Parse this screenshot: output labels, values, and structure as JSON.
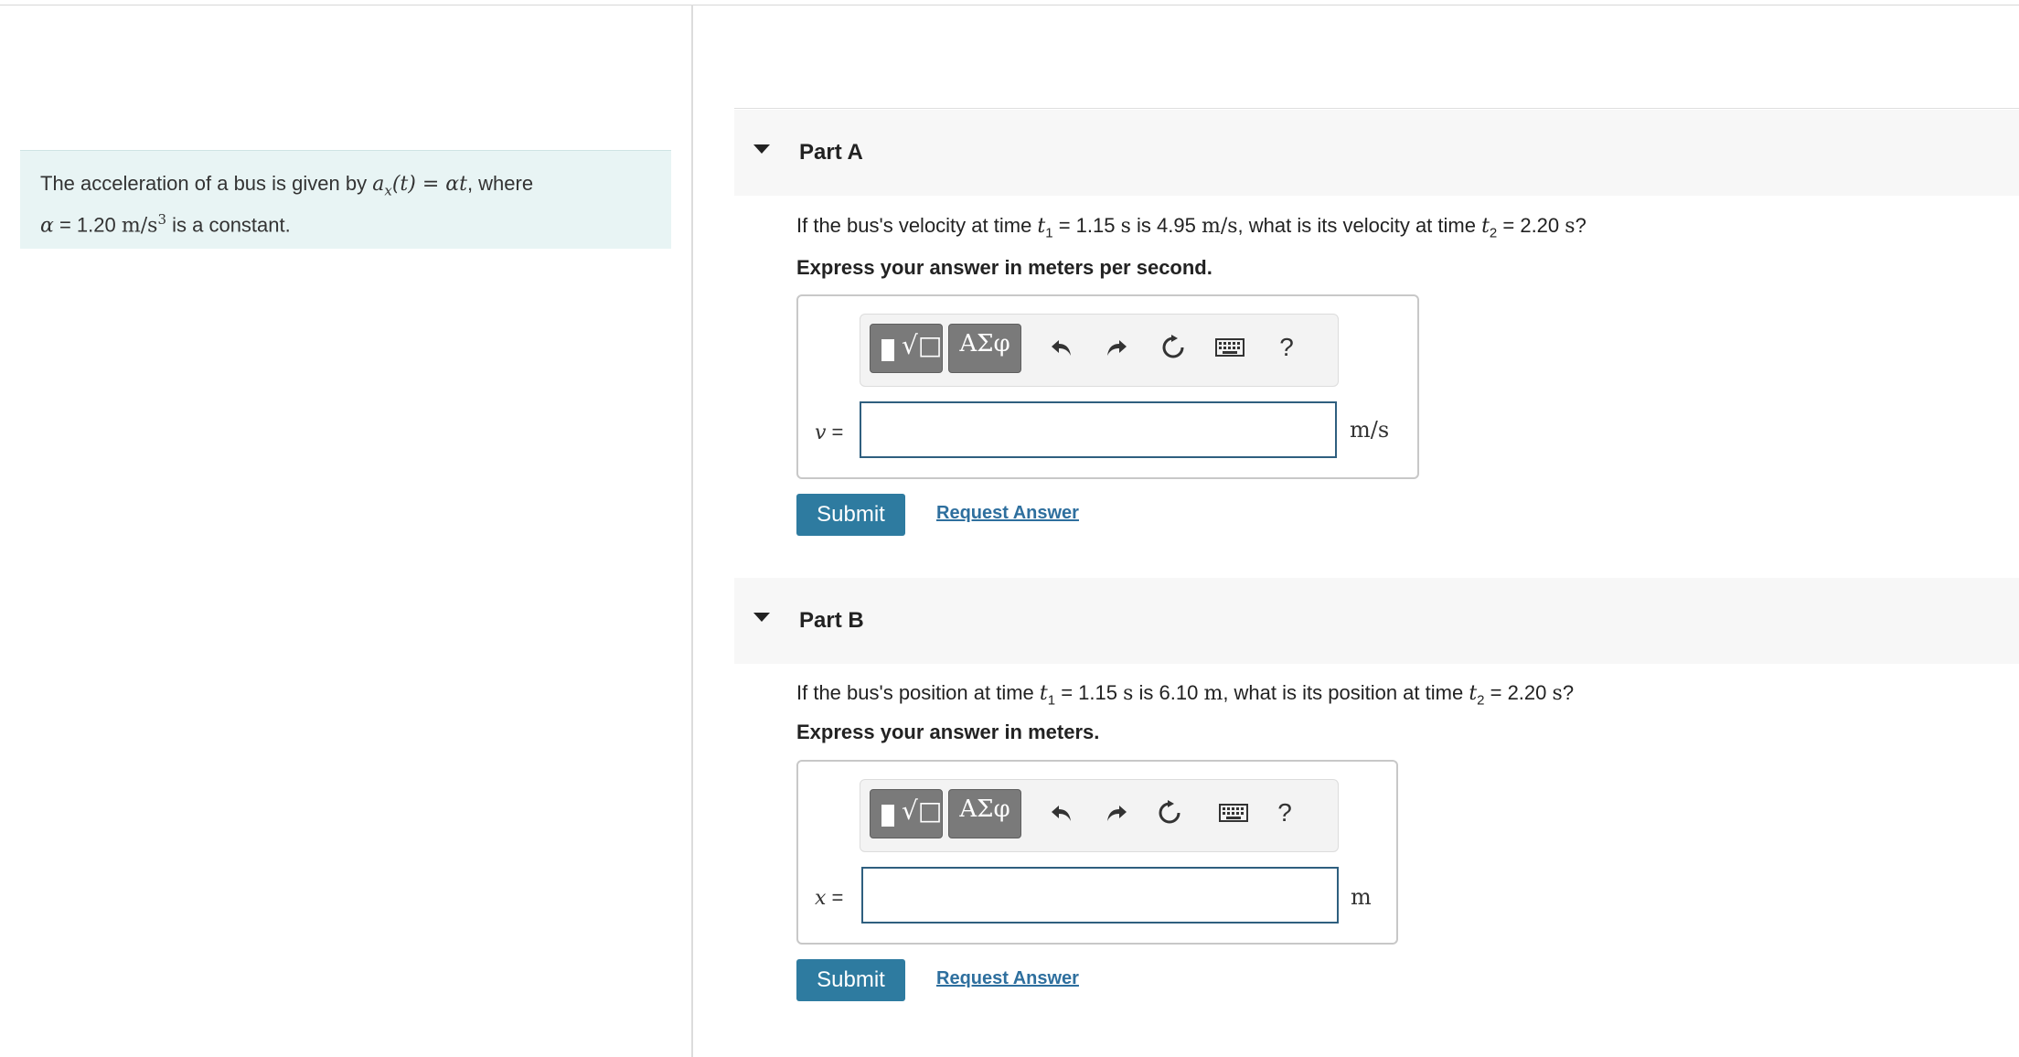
{
  "problem": {
    "intro_prefix": "The acceleration of a bus is given by ",
    "formula_ax": "a",
    "formula_ax_sub": "x",
    "formula_rhs": "(t) = αt",
    "intro_suffix": ", where",
    "alpha_symbol": "α",
    "alpha_eq": " = 1.20 ",
    "alpha_unit": "m/s",
    "alpha_unit_exp": "3",
    "alpha_suffix": " is a constant."
  },
  "parts": [
    {
      "title": "Part A",
      "question": {
        "q1": "If the bus's velocity at time ",
        "t1": "t",
        "t1_sub": "1",
        "q2": " = 1.15 ",
        "s1": "s",
        "q3": " is 4.95 ",
        "v1": "m/s",
        "q4": ", what is its velocity at time ",
        "t2": "t",
        "t2_sub": "2",
        "q5": " = 2.20 ",
        "s2": "s",
        "q6": "?"
      },
      "instruction": "Express your answer in meters per second.",
      "variable": "v",
      "equals": " =",
      "input_value": "",
      "unit": "m/s",
      "submit_label": "Submit",
      "request_label": "Request Answer"
    },
    {
      "title": "Part B",
      "question": {
        "q1": "If the bus's position at time ",
        "t1": "t",
        "t1_sub": "1",
        "q2": " = 1.15 ",
        "s1": "s",
        "q3": " is 6.10 ",
        "v1": "m",
        "q4": ", what is its position at time ",
        "t2": "t",
        "t2_sub": "2",
        "q5": " = 2.20 ",
        "s2": "s",
        "q6": "?"
      },
      "instruction": "Express your answer in meters.",
      "variable": "x",
      "equals": " =",
      "input_value": "",
      "unit": "m",
      "submit_label": "Submit",
      "request_label": "Request Answer"
    }
  ],
  "toolbar": {
    "greek_label": "ΑΣφ",
    "help_label": "?",
    "icons": [
      "templates-icon",
      "greek-letters-icon",
      "undo-icon",
      "redo-icon",
      "reset-icon",
      "keyboard-icon",
      "help-icon"
    ]
  },
  "colors": {
    "problem_bg": "#e8f4f4",
    "submit_bg": "#2e7ba0",
    "link": "#2e6f9e",
    "input_border": "#2f5f7f"
  }
}
